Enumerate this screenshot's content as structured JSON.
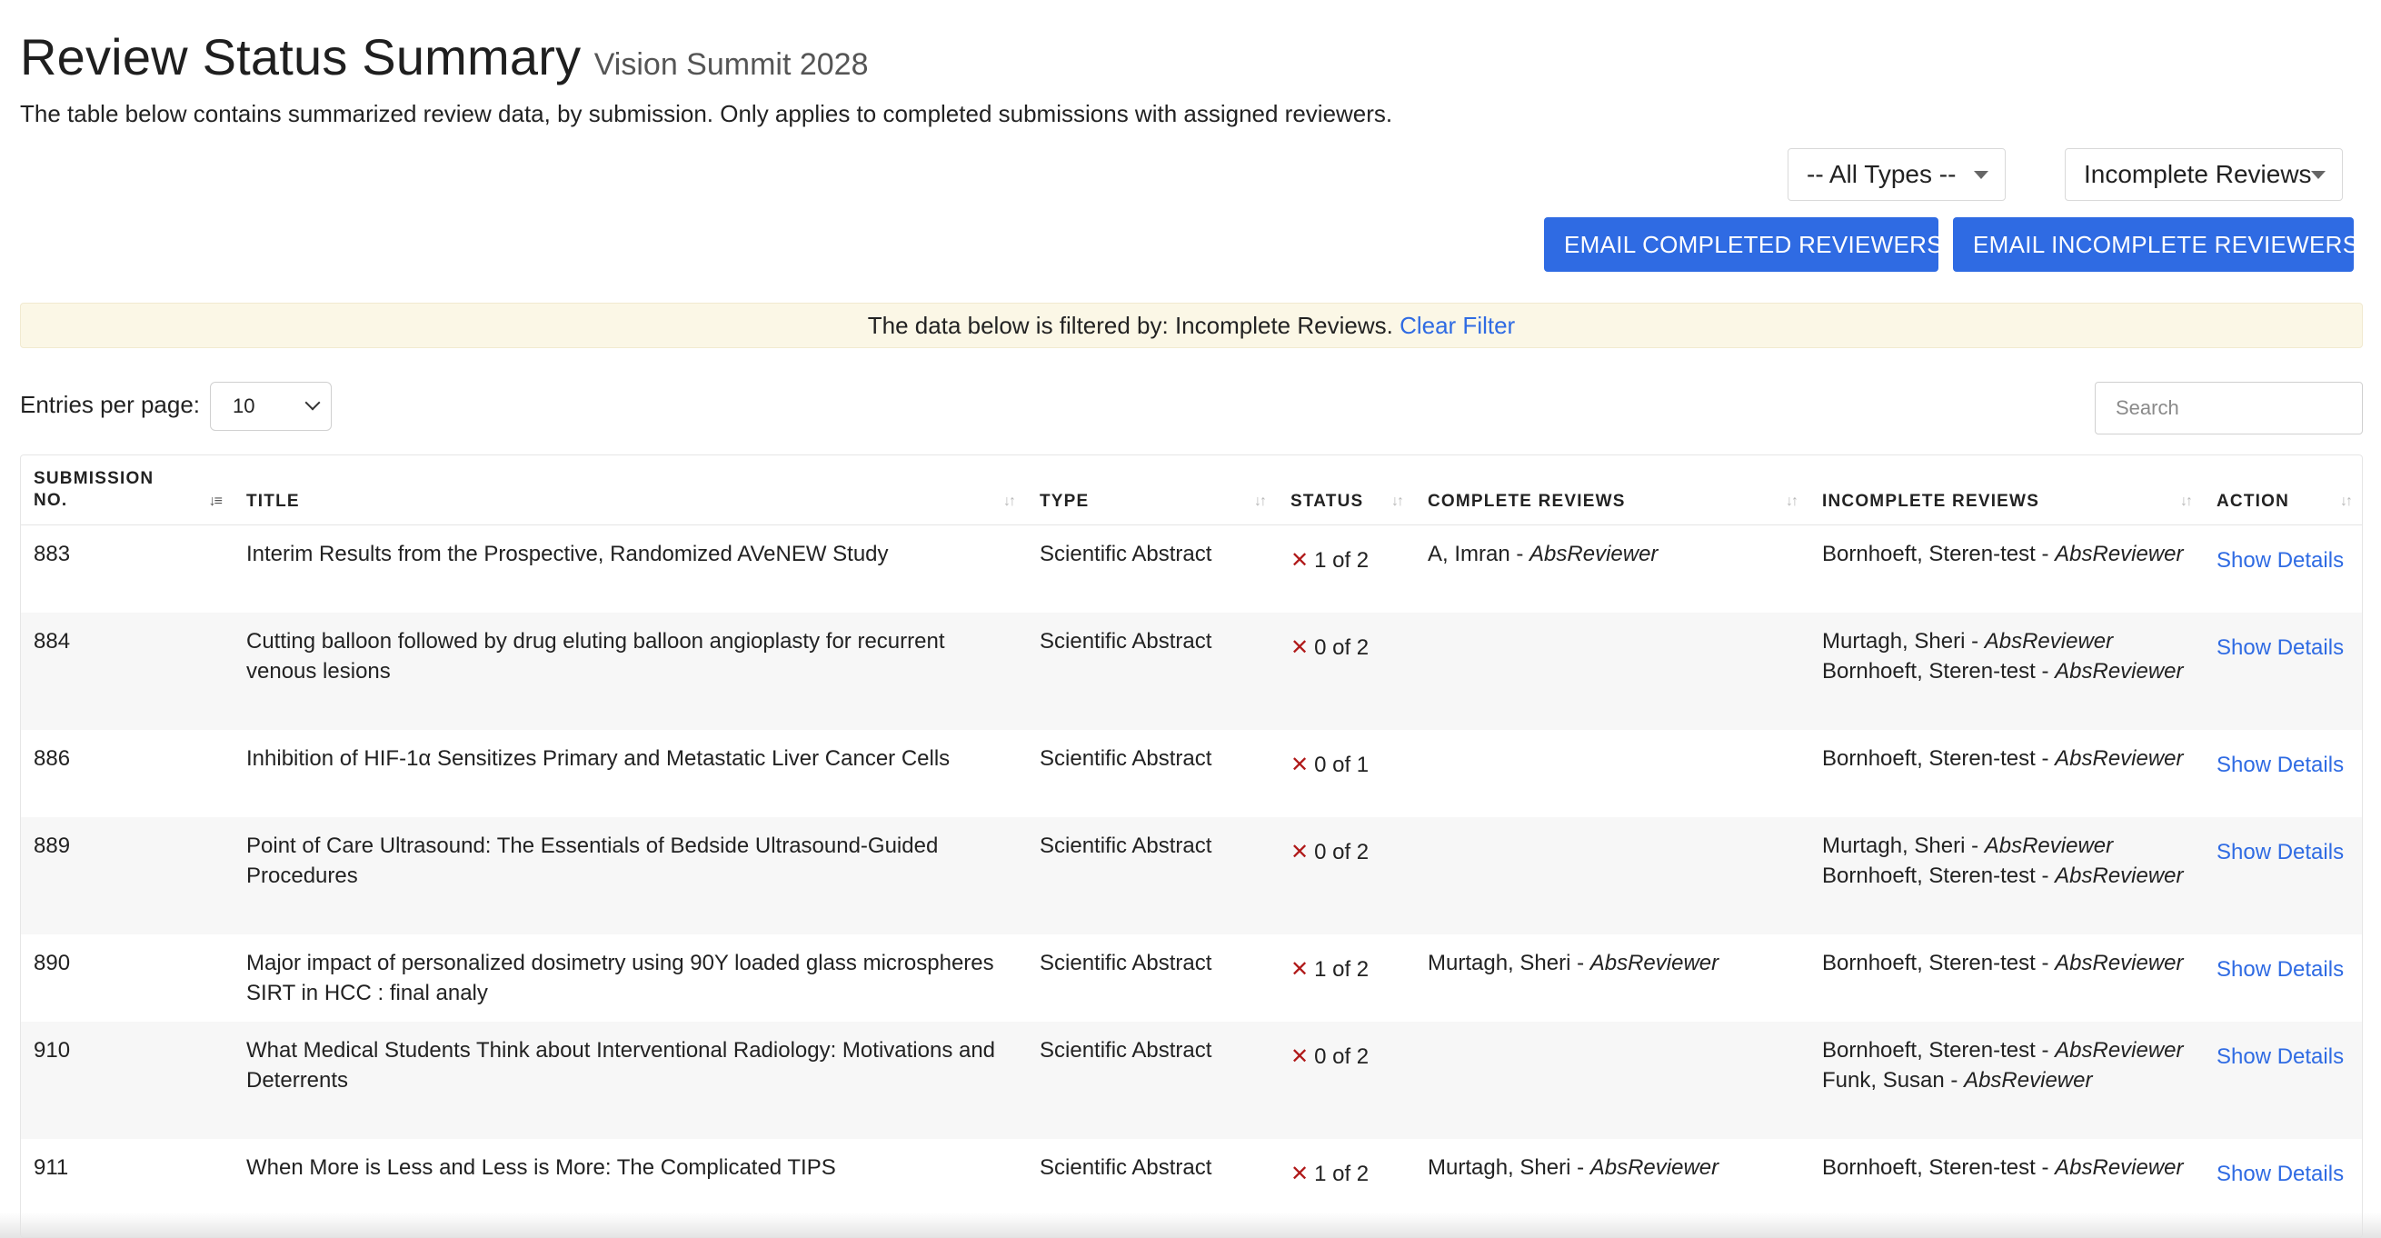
{
  "header": {
    "title": "Review Status Summary",
    "subtitle": "Vision Summit 2028",
    "description": "The table below contains summarized review data, by submission. Only applies to completed submissions with assigned reviewers."
  },
  "filters": {
    "type_select_value": "-- All Types --",
    "review_select_value": "Incomplete Reviews"
  },
  "buttons": {
    "email_completed": "EMAIL COMPLETED REVIEWERS",
    "email_incomplete": "EMAIL INCOMPLETE REVIEWERS"
  },
  "banner": {
    "text": "The data below is filtered by: Incomplete Reviews.",
    "clear_label": "Clear Filter"
  },
  "entries": {
    "label": "Entries per page:",
    "value": "10"
  },
  "search": {
    "placeholder": "Search"
  },
  "table": {
    "columns": {
      "submission_no": "SUBMISSION NO.",
      "title": "TITLE",
      "type": "TYPE",
      "status": "STATUS",
      "complete_reviews": "COMPLETE REVIEWS",
      "incomplete_reviews": "INCOMPLETE REVIEWS",
      "action": "ACTION"
    },
    "rows": [
      {
        "no": "883",
        "title": "Interim Results from the Prospective, Randomized AVeNEW Study",
        "type": "Scientific Abstract",
        "status": "1 of 2",
        "complete": [
          {
            "name": "A, Imran - ",
            "role": "AbsReviewer"
          }
        ],
        "incomplete": [
          {
            "name": "Bornhoeft, Steren-test - ",
            "role": "AbsReviewer"
          }
        ],
        "action": "Show Details"
      },
      {
        "no": "884",
        "title": "Cutting balloon followed by drug eluting balloon angioplasty for recurrent venous lesions",
        "type": "Scientific Abstract",
        "status": "0 of 2",
        "complete": [],
        "incomplete": [
          {
            "name": "Murtagh, Sheri - ",
            "role": "AbsReviewer"
          },
          {
            "name": "Bornhoeft, Steren-test - ",
            "role": "AbsReviewer"
          }
        ],
        "action": "Show Details"
      },
      {
        "no": "886",
        "title": "Inhibition of HIF-1α Sensitizes Primary and Metastatic Liver Cancer Cells",
        "type": "Scientific Abstract",
        "status": "0 of 1",
        "complete": [],
        "incomplete": [
          {
            "name": "Bornhoeft, Steren-test - ",
            "role": "AbsReviewer"
          }
        ],
        "action": "Show Details"
      },
      {
        "no": "889",
        "title": "Point of Care Ultrasound: The Essentials of Bedside Ultrasound-Guided Procedures",
        "type": "Scientific Abstract",
        "status": "0 of 2",
        "complete": [],
        "incomplete": [
          {
            "name": "Murtagh, Sheri - ",
            "role": "AbsReviewer"
          },
          {
            "name": "Bornhoeft, Steren-test - ",
            "role": "AbsReviewer"
          }
        ],
        "action": "Show Details"
      },
      {
        "no": "890",
        "title": "Major impact of personalized dosimetry using 90Y loaded glass microspheres SIRT in HCC : final analy",
        "type": "Scientific Abstract",
        "status": "1 of 2",
        "complete": [
          {
            "name": "Murtagh, Sheri - ",
            "role": "AbsReviewer"
          }
        ],
        "incomplete": [
          {
            "name": "Bornhoeft, Steren-test - ",
            "role": "AbsReviewer"
          }
        ],
        "action": "Show Details"
      },
      {
        "no": "910",
        "title": "What Medical Students Think about Interventional Radiology: Motivations and Deterrents",
        "type": "Scientific Abstract",
        "status": "0 of 2",
        "complete": [],
        "incomplete": [
          {
            "name": "Bornhoeft, Steren-test - ",
            "role": "AbsReviewer"
          },
          {
            "name": "Funk, Susan - ",
            "role": "AbsReviewer"
          }
        ],
        "action": "Show Details"
      },
      {
        "no": "911",
        "title": "When More is Less and Less is More: The Complicated TIPS",
        "type": "Scientific Abstract",
        "status": "1 of 2",
        "complete": [
          {
            "name": "Murtagh, Sheri - ",
            "role": "AbsReviewer"
          }
        ],
        "incomplete": [
          {
            "name": "Bornhoeft, Steren-test - ",
            "role": "AbsReviewer"
          }
        ],
        "action": "Show Details"
      }
    ]
  },
  "icons": {
    "status_incomplete": "x-mark-icon",
    "sort": "sort-arrows-icon",
    "dropdown": "caret-down-icon"
  },
  "colors": {
    "accent": "#2f6be3",
    "status_error": "#b01919",
    "banner_bg": "#fbf7e6"
  }
}
